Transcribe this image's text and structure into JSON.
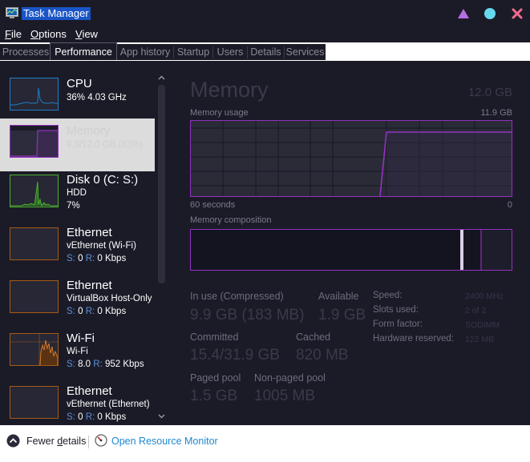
{
  "window": {
    "title": "Task Manager",
    "controls": [
      "triangle-icon",
      "circle-icon",
      "x-icon"
    ],
    "control_colors": {
      "triangle": "#b56fe0",
      "circle": "#66d9ee",
      "close": "#f06c8f"
    }
  },
  "menu": [
    {
      "pre": "",
      "u": "F",
      "post": "ile"
    },
    {
      "pre": "",
      "u": "O",
      "post": "ptions"
    },
    {
      "pre": "",
      "u": "V",
      "post": "iew"
    }
  ],
  "tabs": [
    "Processes",
    "Performance",
    "App history",
    "Startup",
    "Users",
    "Details",
    "Services"
  ],
  "active_tab": "Performance",
  "sidebar": [
    {
      "name": "CPU",
      "sub1": "36%  4.03 GHz",
      "sub2": "",
      "border": "#1e7fc7",
      "graph": "cpu-graph"
    },
    {
      "name": "Memory",
      "sub1": "9.9/12.0 GB (83%)",
      "sub2": "",
      "border": "#9132bd",
      "graph": "memory-graph",
      "selected": true
    },
    {
      "name": "Disk 0 (C: S:)",
      "sub1": "HDD",
      "sub2": "7%",
      "border": "#4bb12a",
      "graph": "disk-graph"
    },
    {
      "name": "Ethernet",
      "sub1": "vEthernet (Wi-Fi)",
      "sub2": {
        "s_label": "S:",
        "s": "0",
        "r_label": "R:",
        "r": "0 Kbps"
      },
      "border": "#a45a14",
      "graph": "ethernet-graph"
    },
    {
      "name": "Ethernet",
      "sub1": "VirtualBox Host-Only",
      "sub2": {
        "s_label": "S:",
        "s": "0",
        "r_label": "R:",
        "r": "0 Kbps"
      },
      "border": "#a45a14",
      "graph": "ethernet-graph"
    },
    {
      "name": "Wi-Fi",
      "sub1": "Wi-Fi",
      "sub2": {
        "s_label": "S:",
        "s": "8.0",
        "r_label": "R:",
        "r": "952 Kbps"
      },
      "border": "#a45a14",
      "graph": "wifi-graph"
    },
    {
      "name": "Ethernet",
      "sub1": "vEthernet (Ethernet)",
      "sub2": {
        "s_label": "S:",
        "s": "0",
        "r_label": "R:",
        "r": "0 Kbps"
      },
      "border": "#a45a14",
      "graph": "ethernet-graph"
    }
  ],
  "panel": {
    "title": "Memory",
    "total": "12.0 GB",
    "usage_label": "Memory usage",
    "usage_max": "11.9 GB",
    "time_left": "60 seconds",
    "time_right": "0",
    "composition_label": "Memory composition",
    "accent": "#9132bd",
    "stats": [
      {
        "label": "In use (Compressed)",
        "value": "9.9 GB (183 MB)"
      },
      {
        "label": "Available",
        "value": "1.9 GB"
      },
      {
        "label": "Committed",
        "value": "15.4/31.9 GB"
      },
      {
        "label": "Cached",
        "value": "820 MB"
      },
      {
        "label": "Paged pool",
        "value": "1.5 GB"
      },
      {
        "label": "Non-paged pool",
        "value": "1005 MB"
      }
    ],
    "details": [
      {
        "label": "Speed:",
        "value": "2400 MHz"
      },
      {
        "label": "Slots used:",
        "value": "2 of 2"
      },
      {
        "label": "Form factor:",
        "value": "SODIMM"
      },
      {
        "label": "Hardware reserved:",
        "value": "122 MB"
      }
    ]
  },
  "footer": {
    "fewer_pre": "Fewer ",
    "fewer_u": "d",
    "fewer_post": "etails",
    "resource_monitor": "Open Resource Monitor"
  }
}
